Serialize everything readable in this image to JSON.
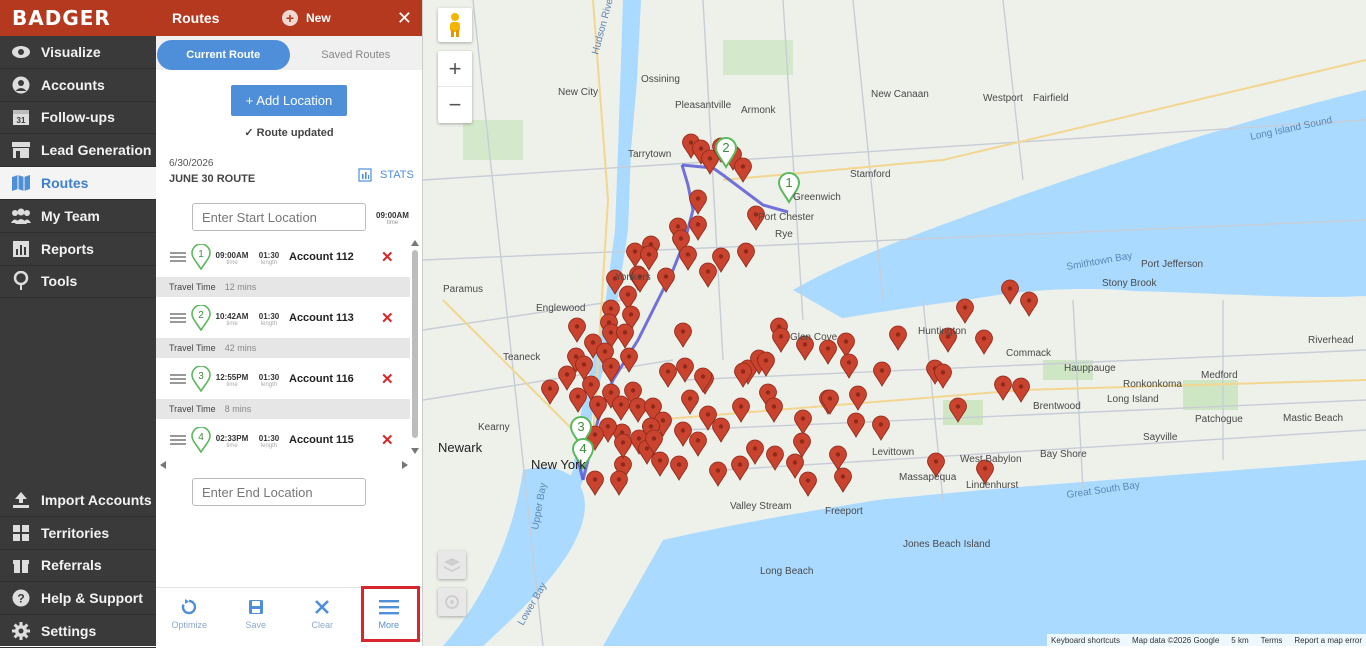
{
  "brand": "BADGER",
  "nav": {
    "top_items": [
      {
        "label": "Visualize",
        "icon": "eye-icon"
      },
      {
        "label": "Accounts",
        "icon": "person-icon"
      },
      {
        "label": "Follow-ups",
        "icon": "calendar-icon"
      },
      {
        "label": "Lead Generation",
        "icon": "store-icon"
      },
      {
        "label": "Routes",
        "icon": "map-icon",
        "active": true
      },
      {
        "label": "My Team",
        "icon": "team-icon"
      },
      {
        "label": "Reports",
        "icon": "report-icon"
      },
      {
        "label": "Tools",
        "icon": "pin-icon"
      }
    ],
    "bottom_items": [
      {
        "label": "Import Accounts",
        "icon": "upload-icon"
      },
      {
        "label": "Territories",
        "icon": "grid-icon"
      },
      {
        "label": "Referrals",
        "icon": "gift-icon"
      },
      {
        "label": "Help & Support",
        "icon": "help-icon"
      },
      {
        "label": "Settings",
        "icon": "gear-icon"
      }
    ]
  },
  "panel": {
    "title": "Routes",
    "new_label": "New",
    "close": "✕",
    "tabs": [
      "Current Route",
      "Saved Routes"
    ],
    "add_location": "+ Add Location",
    "status": "✓  Route updated",
    "route_date": "6/30/2026",
    "route_name": "JUNE 30 ROUTE",
    "stats_label": "STATS",
    "start_placeholder": "Enter Start Location",
    "start_time": "09:00AM",
    "time_caption": "time",
    "length_caption": "length",
    "end_placeholder": "Enter End Location",
    "stops": [
      {
        "num": "1",
        "time": "09:00AM",
        "length": "01:30",
        "account": "Account 112",
        "travel_label": "Travel Time",
        "travel": "12 mins"
      },
      {
        "num": "2",
        "time": "10:42AM",
        "length": "01:30",
        "account": "Account 113",
        "travel_label": "Travel Time",
        "travel": "42 mins"
      },
      {
        "num": "3",
        "time": "12:55PM",
        "length": "01:30",
        "account": "Account 116",
        "travel_label": "Travel Time",
        "travel": "8 mins"
      },
      {
        "num": "4",
        "time": "02:33PM",
        "length": "01:30",
        "account": "Account 115"
      }
    ],
    "toolbar": [
      {
        "label": "Optimize",
        "icon": "refresh-icon"
      },
      {
        "label": "Save",
        "icon": "save-icon"
      },
      {
        "label": "Clear",
        "icon": "clear-icon"
      },
      {
        "label": "More",
        "icon": "menu-icon"
      }
    ]
  },
  "map": {
    "zoom_in": "+",
    "zoom_out": "−",
    "labels": [
      "Hudson River",
      "New City",
      "Ossining",
      "Pleasantville",
      "Armonk",
      "New Canaan",
      "Westport",
      "Fairfield",
      "Tarrytown",
      "Stamford",
      "Greenwich",
      "Port Chester",
      "Rye",
      "Long Island Sound",
      "Yonkers",
      "Paramus",
      "Englewood",
      "Glen Cove",
      "Huntington",
      "Commack",
      "Port Jefferson",
      "Stony Brook",
      "Smithtown Bay",
      "Hauppauge",
      "Riverhead",
      "Ronkonkoma",
      "Medford",
      "Brentwood",
      "Long Island",
      "Patchogue",
      "Mastic Beach",
      "Newark",
      "New York",
      "Levittown",
      "West Babylon",
      "Bay Shore",
      "Great South Bay",
      "Valley Stream",
      "Freeport",
      "Massapequa",
      "Lindenhurst",
      "Jones Beach Island",
      "Long Beach",
      "Upper Bay",
      "Lower Bay",
      "Kearny",
      "Teaneck",
      "Sayville"
    ],
    "attribution": [
      "Keyboard shortcuts",
      "Map data ©2026 Google",
      "5 km",
      "Terms",
      "Report a map error"
    ]
  },
  "colors": {
    "brand": "#b5391e",
    "accent": "#4f8fd9",
    "nav_bg": "#3a3a3a",
    "pin_red": "#c9432e",
    "pin_green": "#5cb85c",
    "route_line": "#5b5bd6"
  }
}
